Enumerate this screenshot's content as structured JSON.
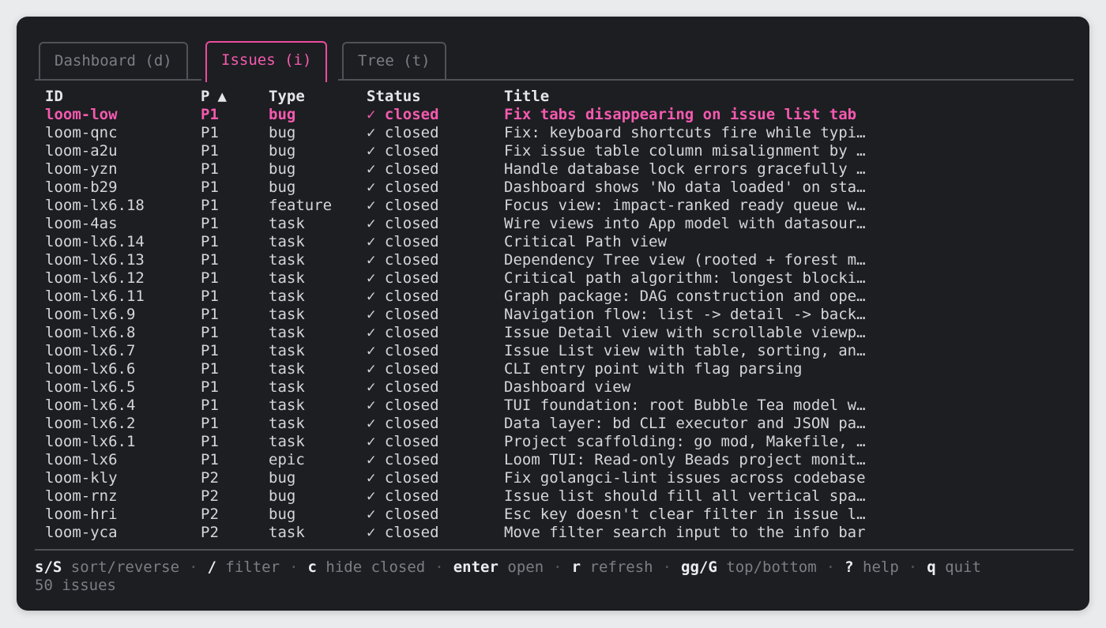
{
  "tabs": [
    {
      "label": "Dashboard (d)",
      "active": false
    },
    {
      "label": "Issues (i)",
      "active": true
    },
    {
      "label": "Tree (t)",
      "active": false
    }
  ],
  "table": {
    "columns": {
      "id": "ID",
      "priority": "P",
      "sort_indicator": "▲",
      "type": "Type",
      "status": "Status",
      "title": "Title"
    },
    "status_check": "✓",
    "rows": [
      {
        "id": "loom-low",
        "p": "P1",
        "type": "bug",
        "status": "closed",
        "title": "Fix tabs disappearing on issue list tab",
        "selected": true
      },
      {
        "id": "loom-qnc",
        "p": "P1",
        "type": "bug",
        "status": "closed",
        "title": "Fix: keyboard shortcuts fire while typi…"
      },
      {
        "id": "loom-a2u",
        "p": "P1",
        "type": "bug",
        "status": "closed",
        "title": "Fix issue table column misalignment by …"
      },
      {
        "id": "loom-yzn",
        "p": "P1",
        "type": "bug",
        "status": "closed",
        "title": "Handle database lock errors gracefully …"
      },
      {
        "id": "loom-b29",
        "p": "P1",
        "type": "bug",
        "status": "closed",
        "title": "Dashboard shows 'No data loaded' on sta…"
      },
      {
        "id": "loom-lx6.18",
        "p": "P1",
        "type": "feature",
        "status": "closed",
        "title": "Focus view: impact-ranked ready queue w…"
      },
      {
        "id": "loom-4as",
        "p": "P1",
        "type": "task",
        "status": "closed",
        "title": "Wire views into App model with datasour…"
      },
      {
        "id": "loom-lx6.14",
        "p": "P1",
        "type": "task",
        "status": "closed",
        "title": "Critical Path view"
      },
      {
        "id": "loom-lx6.13",
        "p": "P1",
        "type": "task",
        "status": "closed",
        "title": "Dependency Tree view (rooted + forest m…"
      },
      {
        "id": "loom-lx6.12",
        "p": "P1",
        "type": "task",
        "status": "closed",
        "title": "Critical path algorithm: longest blocki…"
      },
      {
        "id": "loom-lx6.11",
        "p": "P1",
        "type": "task",
        "status": "closed",
        "title": "Graph package: DAG construction and ope…"
      },
      {
        "id": "loom-lx6.9",
        "p": "P1",
        "type": "task",
        "status": "closed",
        "title": "Navigation flow: list -> detail -> back…"
      },
      {
        "id": "loom-lx6.8",
        "p": "P1",
        "type": "task",
        "status": "closed",
        "title": "Issue Detail view with scrollable viewp…"
      },
      {
        "id": "loom-lx6.7",
        "p": "P1",
        "type": "task",
        "status": "closed",
        "title": "Issue List view with table, sorting, an…"
      },
      {
        "id": "loom-lx6.6",
        "p": "P1",
        "type": "task",
        "status": "closed",
        "title": "CLI entry point with flag parsing"
      },
      {
        "id": "loom-lx6.5",
        "p": "P1",
        "type": "task",
        "status": "closed",
        "title": "Dashboard view"
      },
      {
        "id": "loom-lx6.4",
        "p": "P1",
        "type": "task",
        "status": "closed",
        "title": "TUI foundation: root Bubble Tea model w…"
      },
      {
        "id": "loom-lx6.2",
        "p": "P1",
        "type": "task",
        "status": "closed",
        "title": "Data layer: bd CLI executor and JSON pa…"
      },
      {
        "id": "loom-lx6.1",
        "p": "P1",
        "type": "task",
        "status": "closed",
        "title": "Project scaffolding: go mod, Makefile, …"
      },
      {
        "id": "loom-lx6",
        "p": "P1",
        "type": "epic",
        "status": "closed",
        "title": "Loom TUI: Read-only Beads project monit…"
      },
      {
        "id": "loom-kly",
        "p": "P2",
        "type": "bug",
        "status": "closed",
        "title": "Fix golangci-lint issues across codebase"
      },
      {
        "id": "loom-rnz",
        "p": "P2",
        "type": "bug",
        "status": "closed",
        "title": "Issue list should fill all vertical spa…"
      },
      {
        "id": "loom-hri",
        "p": "P2",
        "type": "bug",
        "status": "closed",
        "title": "Esc key doesn't clear filter in issue l…"
      },
      {
        "id": "loom-yca",
        "p": "P2",
        "type": "task",
        "status": "closed",
        "title": "Move filter search input to the info bar"
      }
    ]
  },
  "footer": {
    "hints": [
      {
        "key": "s/S",
        "desc": "sort/reverse"
      },
      {
        "key": "/",
        "desc": "filter"
      },
      {
        "key": "c",
        "desc": "hide closed"
      },
      {
        "key": "enter",
        "desc": "open"
      },
      {
        "key": "r",
        "desc": "refresh"
      },
      {
        "key": "gg/G",
        "desc": "top/bottom"
      },
      {
        "key": "?",
        "desc": "help"
      },
      {
        "key": "q",
        "desc": "quit"
      }
    ],
    "separator": "·",
    "count_label": "50 issues"
  },
  "colors": {
    "accent": "#f55ab0",
    "background": "#1d1e21",
    "text": "#d4d6da",
    "muted": "#7b7e84",
    "border": "#505257"
  }
}
